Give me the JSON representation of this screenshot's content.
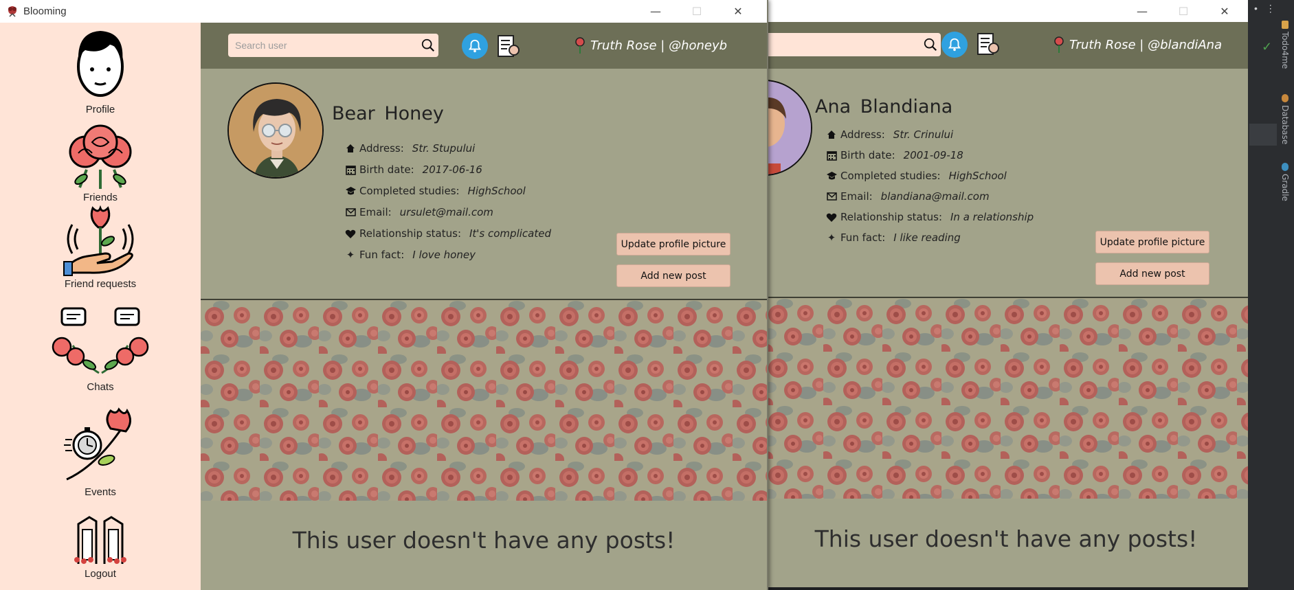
{
  "ide": {
    "panels": [
      {
        "label": "Todo4me",
        "icon": "todo-icon"
      },
      {
        "label": "Database",
        "icon": "database-icon"
      },
      {
        "label": "Gradle",
        "icon": "gradle-icon"
      }
    ]
  },
  "right_window": {
    "search": {
      "placeholder": ""
    },
    "user_label": "Truth Rose | @blandiAna",
    "profile": {
      "name": "Ana  Blandiana",
      "fields": [
        {
          "icon": "home-icon",
          "label": "Address:",
          "value": "Str. Crinului"
        },
        {
          "icon": "calendar-icon",
          "label": "Birth date:",
          "value": "2001-09-18"
        },
        {
          "icon": "graduation-cap-icon",
          "label": "Completed studies:",
          "value": "HighSchool"
        },
        {
          "icon": "mail-icon",
          "label": "Email:",
          "value": "blandiana@mail.com"
        },
        {
          "icon": "hearts-icon",
          "label": "Relationship status:",
          "value": "In a relationship"
        },
        {
          "icon": "sparkles-icon",
          "label": "Fun fact:",
          "value": "I like reading"
        }
      ],
      "update_picture_label": "Update profile picture",
      "add_post_label": "Add new post"
    },
    "posts_empty_message": "This user doesn't have any posts!"
  },
  "left_window": {
    "title": "Blooming",
    "sidebar": {
      "items": [
        {
          "label": "Profile",
          "icon": "profile-icon"
        },
        {
          "label": "Friends",
          "icon": "rose-bouquet-icon"
        },
        {
          "label": "Friend requests",
          "icon": "rose-in-hand-icon"
        },
        {
          "label": "Chats",
          "icon": "roses-chat-icon"
        },
        {
          "label": "Events",
          "icon": "stopwatch-rose-icon"
        },
        {
          "label": "Logout",
          "icon": "door-icon"
        }
      ]
    },
    "search": {
      "placeholder": "Search user"
    },
    "user_label": "Truth Rose | @honeyb",
    "profile": {
      "name": "Bear  Honey",
      "fields": [
        {
          "icon": "home-icon",
          "label": "Address:",
          "value": "Str. Stupului"
        },
        {
          "icon": "calendar-icon",
          "label": "Birth date:",
          "value": "2017-06-16"
        },
        {
          "icon": "graduation-cap-icon",
          "label": "Completed studies:",
          "value": "HighSchool"
        },
        {
          "icon": "mail-icon",
          "label": "Email:",
          "value": "ursulet@mail.com"
        },
        {
          "icon": "hearts-icon",
          "label": "Relationship status:",
          "value": "It's complicated"
        },
        {
          "icon": "sparkles-icon",
          "label": "Fun fact:",
          "value": "I love honey"
        }
      ],
      "update_picture_label": "Update profile picture",
      "add_post_label": "Add new post"
    },
    "posts_empty_message": "This user doesn't have any posts!"
  },
  "colors": {
    "sidebar_bg": "#ffe4d7",
    "topbar_bg": "#6d6f57",
    "content_bg": "#a2a38a",
    "button_bg": "#ecc3ae",
    "bell_blue": "#2fa1e0"
  }
}
